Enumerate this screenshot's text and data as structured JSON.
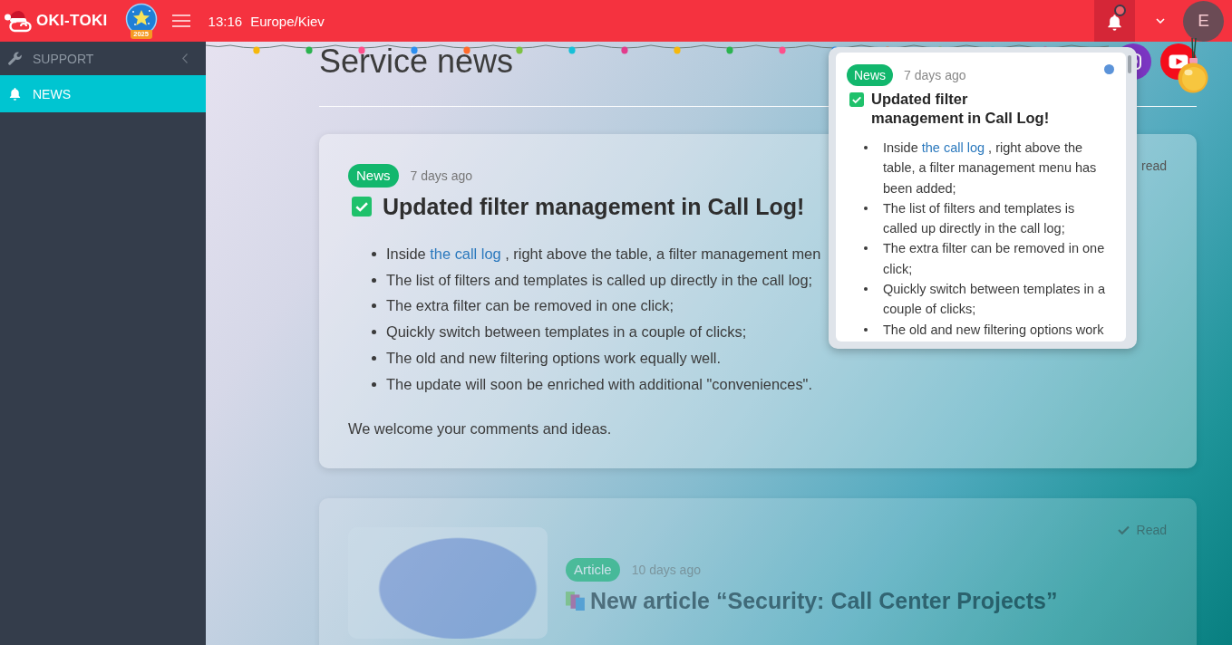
{
  "topbar": {
    "logo": "OKI-TOKI",
    "year_badge": "2025",
    "time": "13:16",
    "timezone": "Europe/Kiev",
    "notifications": {
      "open": true,
      "unread": true
    },
    "avatar": "E"
  },
  "sidebar": {
    "items": [
      {
        "label": "SUPPORT",
        "kind": "group",
        "expanded": false,
        "selected": false
      },
      {
        "label": "NEWS",
        "kind": "link",
        "selected": true
      }
    ]
  },
  "main": {
    "title": "Service news",
    "cards": [
      {
        "kind": "news",
        "badge": "News",
        "age": "7 days ago",
        "read": false,
        "read_label": "read",
        "title": "Updated filter management in Call Log!",
        "items": [
          {
            "text": "Inside ",
            "link": "the call log",
            "rest": " , right above the table, a filter management men"
          },
          {
            "text": "The list of filters and templates is called up directly in the call log;"
          },
          {
            "text": "The extra filter can be removed in one click;"
          },
          {
            "text": "Quickly switch between templates in a couple of clicks;"
          },
          {
            "text": "The old and new filtering options work equally well."
          },
          {
            "text": "The update will soon be enriched with additional \"conveniences\"."
          }
        ],
        "footer": "We welcome your comments and ideas."
      },
      {
        "kind": "article",
        "badge": "Article",
        "age": "10 days ago",
        "read": true,
        "read_label": "Read",
        "title": "New article “Security: Call Center Projects”"
      }
    ]
  },
  "notifications_popup": {
    "items": [
      {
        "badge": "News",
        "age": "7 days ago",
        "unread": true,
        "title": "Updated filter management in Call Log!",
        "items": [
          {
            "text": "Inside ",
            "link": "the call log",
            "rest": " , right above the table, a filter management menu has been added;"
          },
          {
            "text": "The list of filters and templates is called up directly in the call log;"
          },
          {
            "text": "The extra filter can be removed in one click;"
          },
          {
            "text": "Quickly switch between templates in a couple of clicks;"
          },
          {
            "text": "The old and new filtering options work"
          }
        ]
      }
    ]
  }
}
